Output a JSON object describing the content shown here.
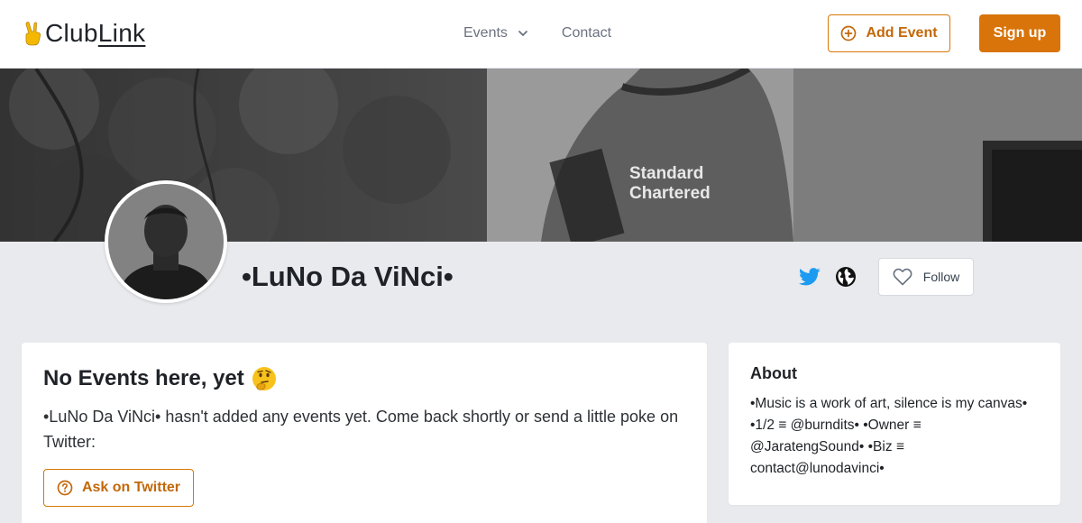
{
  "header": {
    "logo_prefix": "Club",
    "logo_suffix": "Link",
    "nav": {
      "events_label": "Events",
      "contact_label": "Contact"
    },
    "add_event_label": "Add Event",
    "signup_label": "Sign up"
  },
  "profile": {
    "name": "•LuNo Da ViNci•",
    "follow_label": "Follow"
  },
  "events_card": {
    "title": "No Events here, yet",
    "message": "•LuNo Da ViNci• hasn't added any events yet. Come back shortly or send a little poke on Twitter:",
    "ask_button_label": "Ask on Twitter"
  },
  "about_card": {
    "title": "About",
    "text": "•Music is a work of art, silence is my canvas• •1/2 ≡ @burndits• •Owner ≡ @JaratengSound• •Biz ≡ contact@lunodavinci•"
  },
  "colors": {
    "accent": "#d9740a",
    "twitter": "#1d9bf0",
    "background": "#e9eaee"
  }
}
